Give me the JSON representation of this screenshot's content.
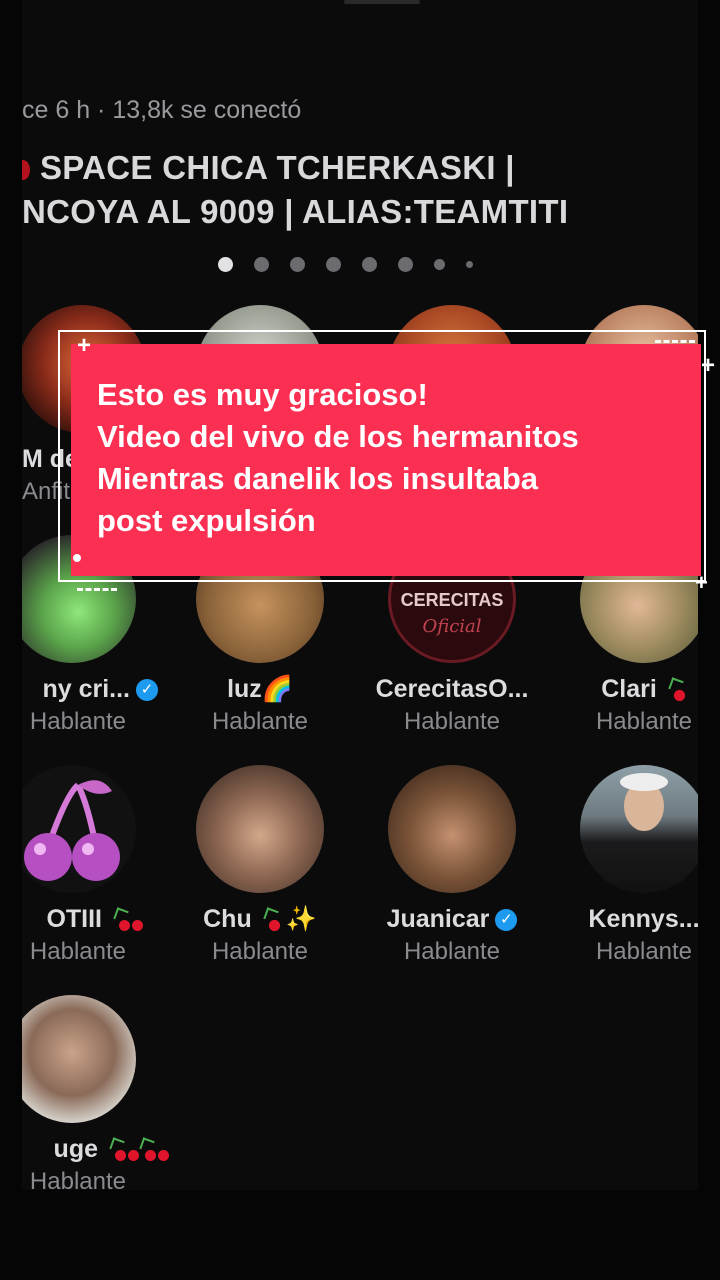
{
  "header": {
    "meta": "ce 6 h · 13,8k se conectó",
    "title_line1": "SPACE CHICA TCHERKASKI |",
    "title_line2": "NCOYA AL 9009 | ALIAS:TEAMTITI",
    "page_count": 8,
    "active_page": 1
  },
  "speakers": [
    {
      "name": "M de",
      "role": "Anfit"
    },
    {
      "name": "",
      "role": ""
    },
    {
      "name": "",
      "role": ""
    },
    {
      "name": "",
      "role": ""
    },
    {
      "name": "ny cri...",
      "role": "Hablante",
      "verified": true
    },
    {
      "name": "luz🌈",
      "role": "Hablante"
    },
    {
      "name": "CerecitasO...",
      "role": "Hablante"
    },
    {
      "name": "Clari",
      "role": "Hablante",
      "cherry": true
    },
    {
      "name": "OTIII",
      "role": "Hablante",
      "cherry": true
    },
    {
      "name": "Chu",
      "role": "Hablante",
      "cherry": true,
      "sparkle": "✨"
    },
    {
      "name": "Juanicar",
      "role": "Hablante",
      "verified": true
    },
    {
      "name": "Kennys...",
      "role": "Hablante"
    },
    {
      "name": "uge",
      "role": "Hablante",
      "cherry": true
    }
  ],
  "logo_text": {
    "line1": "CERECITAS",
    "line2": "Oficial"
  },
  "caption": {
    "line1": "Esto es muy gracioso!",
    "line2": "Video del vivo de los hermanitos",
    "line3": "Mientras danelik los insultaba",
    "line4": "post expulsión"
  },
  "colors": {
    "caption_bg": "#fb2f52",
    "background": "#0b0b0c",
    "verified": "#1d9bf0"
  }
}
